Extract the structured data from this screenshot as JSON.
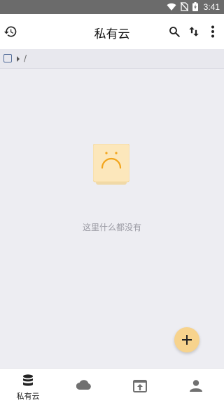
{
  "status_bar": {
    "time": "3:41"
  },
  "app_bar": {
    "title": "私有云"
  },
  "path_bar": {
    "root": "/"
  },
  "empty_state": {
    "message": "这里什么都没有"
  },
  "bottom_nav": {
    "items": [
      {
        "label": "私有云",
        "icon": "database-icon",
        "selected": true
      },
      {
        "label": "",
        "icon": "cloud-icon",
        "selected": false
      },
      {
        "label": "",
        "icon": "upload-icon",
        "selected": false
      },
      {
        "label": "",
        "icon": "person-icon",
        "selected": false
      }
    ]
  },
  "colors": {
    "accent": "#f7d38d",
    "sad_face": "#f2a51c",
    "background": "#ededf2"
  }
}
